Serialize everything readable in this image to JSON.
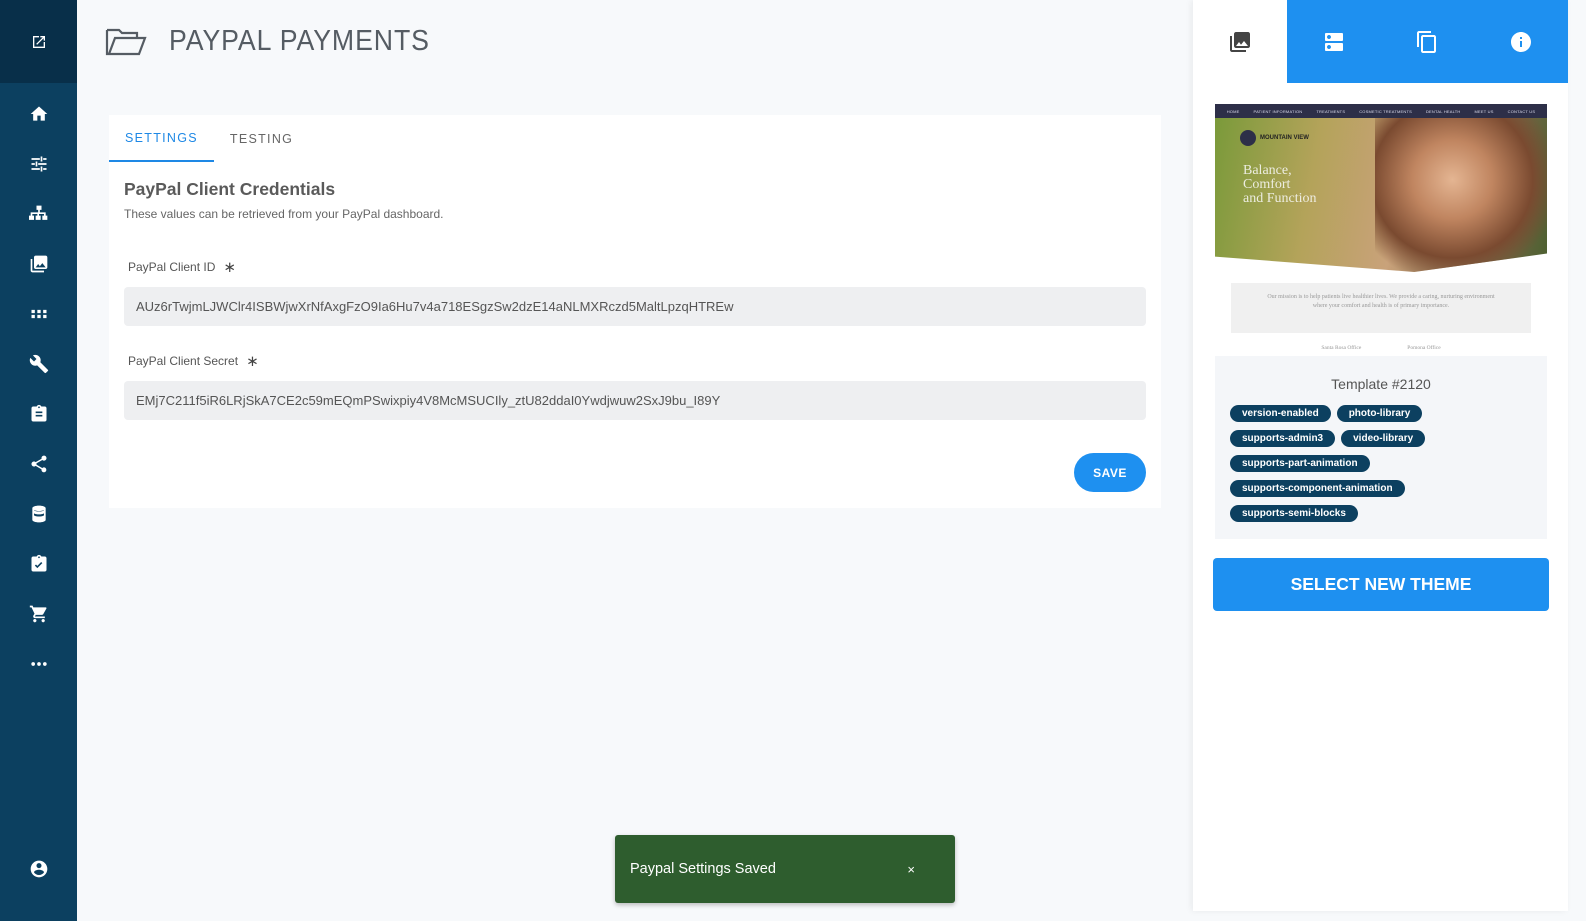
{
  "header": {
    "title": "PAYPAL PAYMENTS"
  },
  "tabs": [
    {
      "label": "SETTINGS"
    },
    {
      "label": "TESTING"
    }
  ],
  "section": {
    "title": "PayPal Client Credentials",
    "description": "These values can be retrieved from your PayPal dashboard."
  },
  "fields": {
    "client_id": {
      "label": "PayPal Client ID",
      "required_mark": "∗",
      "value": "AUz6rTwjmLJWClr4ISBWjwXrNfAxgFzO9Ia6Hu7v4a718ESgzSw2dzE14aNLMXRczd5MaltLpzqHTREw"
    },
    "client_secret": {
      "label": "PayPal Client Secret",
      "required_mark": "∗",
      "value": "EMj7C211f5iR6LRjSkA7CE2c59mEQmPSwixpiy4V8McMSUCIly_ztU82ddaI0Ywdjwuw2SxJ9bu_I89Y"
    }
  },
  "save_label": "SAVE",
  "preview": {
    "nav": [
      "HOME",
      "PATIENT INFORMATION",
      "TREATMENTS",
      "COSMETIC TREATMENTS",
      "DENTAL HEALTH",
      "MEET US",
      "CONTACT US"
    ],
    "logo_text": "MOUNTAIN VIEW",
    "tagline": [
      "Balance,",
      "Comfort",
      "and Function"
    ],
    "mission": "Our mission is to help patients live healthier lives. We provide a caring, nurturing environment where your comfort and health is of primary importance.",
    "offices": [
      "Santa Rosa Office",
      "Pomona Office"
    ]
  },
  "template": {
    "name": "Template #2120",
    "tags": [
      "version-enabled",
      "photo-library",
      "supports-admin3",
      "video-library",
      "supports-part-animation",
      "supports-component-animation",
      "supports-semi-blocks"
    ]
  },
  "select_theme_label": "SELECT NEW THEME",
  "snackbar": {
    "message": "Paypal Settings Saved",
    "close": "×"
  },
  "icons": {
    "sidebar": [
      "external-link-icon",
      "home-icon",
      "sliders-icon",
      "sitemap-icon",
      "images-icon",
      "apps-grid-icon",
      "wrench-icon",
      "clipboard-icon",
      "share-icon",
      "database-icon",
      "clipboard-list-icon",
      "cart-icon",
      "more-icon",
      "account-icon"
    ],
    "right_tabs": [
      "images-icon",
      "server-icon",
      "copy-icon",
      "info-icon"
    ]
  },
  "colors": {
    "sidebar": "#0c4060",
    "accent": "#1e90f0",
    "snackbar": "#2e5d2e"
  }
}
